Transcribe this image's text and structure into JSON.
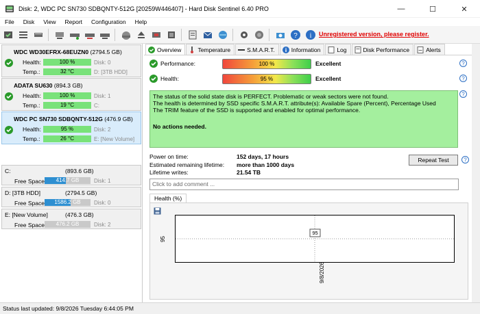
{
  "window": {
    "title": "Disk: 2, WDC PC SN730 SDBQNTY-512G [20259W446407]  -  Hard Disk Sentinel 6.40 PRO",
    "minimize": "—",
    "maximize": "☐",
    "close": "✕"
  },
  "menu": [
    "File",
    "Disk",
    "View",
    "Report",
    "Configuration",
    "Help"
  ],
  "toolbar": {
    "register_notice": "Unregistered version, please register."
  },
  "disks": [
    {
      "name": "WDC WD30EFRX-68EUZN0",
      "capacity": "(2794.5 GB)",
      "health_label": "Health:",
      "health": "100 %",
      "health_pct": 100,
      "disk_tag": "Disk: 0",
      "temp_label": "Temp.:",
      "temp": "32 °C",
      "volume_tag": "D: [3TB HDD]",
      "selected": false
    },
    {
      "name": "ADATA SU630",
      "capacity": "(894.3 GB)",
      "health_label": "Health:",
      "health": "100 %",
      "health_pct": 100,
      "disk_tag": "Disk: 1",
      "temp_label": "Temp.:",
      "temp": "19 °C",
      "volume_tag": "C:",
      "selected": false
    },
    {
      "name": "WDC PC SN730 SDBQNTY-512G",
      "capacity": "(476.9 GB)",
      "health_label": "Health:",
      "health": "95 %",
      "health_pct": 95,
      "disk_tag": "Disk: 2",
      "temp_label": "Temp.:",
      "temp": "26 °C",
      "volume_tag": "E: [New Volume]",
      "selected": true
    }
  ],
  "volumes": [
    {
      "name": "C:",
      "capacity": "(893.6 GB)",
      "free_label": "Free Space",
      "free": "414.7 GB",
      "free_fraction": 0.46,
      "disk": "Disk: 1"
    },
    {
      "name": "D: [3TB HDD]",
      "capacity": "(2794.5 GB)",
      "free_label": "Free Space",
      "free": "1586.2 GB",
      "free_fraction": 0.57,
      "disk": "Disk: 0"
    },
    {
      "name": "E: [New Volume]",
      "capacity": "(476.3 GB)",
      "free_label": "Free Space",
      "free": "476.2 GB",
      "free_fraction": 0.0,
      "disk": "Disk: 2"
    }
  ],
  "tabs": [
    "Overview",
    "Temperature",
    "S.M.A.R.T.",
    "Information",
    "Log",
    "Disk Performance",
    "Alerts"
  ],
  "overview": {
    "performance_label": "Performance:",
    "performance": "100 %",
    "performance_result": "Excellent",
    "health_label": "Health:",
    "health": "95 %",
    "health_result": "Excellent",
    "status_lines": [
      "The status of the solid state disk is PERFECT. Problematic or weak sectors were not found.",
      "The health is determined by SSD specific S.M.A.R.T. attribute(s):  Available Spare (Percent), Percentage Used",
      "The TRIM feature of the SSD is supported and enabled for optimal performance."
    ],
    "action": "No actions needed.",
    "power_on_label": "Power on time:",
    "power_on": "152 days, 17 hours",
    "remaining_label": "Estimated remaining lifetime:",
    "remaining": "more than 1000 days",
    "writes_label": "Lifetime writes:",
    "writes": "21.54 TB",
    "repeat_button": "Repeat Test",
    "comment_placeholder": "Click to add comment ...",
    "chart_tab": "Health (%)",
    "chart_y_tick": "95",
    "chart_point_label": "95",
    "chart_x_tick": "9/8/2026"
  },
  "status_bar": "Status last updated: 9/8/2026 Tuesday 6:44:05 PM",
  "colors": {
    "health_green": "#79e27a",
    "status_green": "#a4ef9e",
    "free_blue": "#2e8fd1",
    "selected_bg": "#d9ecfb",
    "register_red": "#e00000"
  }
}
